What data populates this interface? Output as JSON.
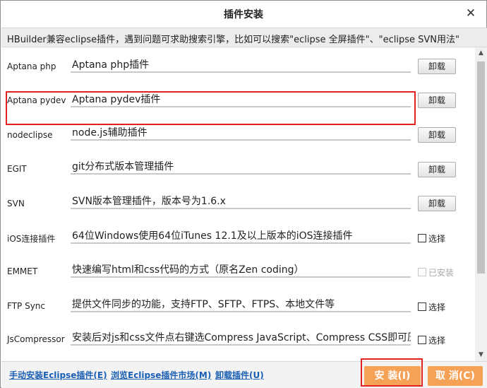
{
  "dialog": {
    "title": "插件安装",
    "close_glyph": "✕"
  },
  "notice": "HBuilder兼容eclipse插件，遇到问题可求助搜索引擎，比如可以搜索\"eclipse 全屏插件\"、\"eclipse SVN用法\"",
  "plugins": [
    {
      "name": "Aptana php",
      "description": "Aptana php插件",
      "action": "卸载",
      "type": "button"
    },
    {
      "name": "Aptana pydev",
      "description": "Aptana pydev插件",
      "action": "卸载",
      "type": "button"
    },
    {
      "name": "nodeclipse",
      "description": "node.js辅助插件",
      "action": "卸载",
      "type": "button"
    },
    {
      "name": "EGIT",
      "description": "git分布式版本管理插件",
      "action": "卸载",
      "type": "button"
    },
    {
      "name": "SVN",
      "description": "SVN版本管理插件，版本号为1.6.x",
      "action": "卸载",
      "type": "button"
    },
    {
      "name": "iOS连接插件",
      "description": "64位Windows使用64位iTunes 12.1及以上版本的iOS连接插件",
      "action": "选择",
      "type": "checkbox"
    },
    {
      "name": "EMMET",
      "description": "快速编写html和css代码的方式（原名Zen coding）",
      "action": "已安装",
      "type": "checkbox-disabled"
    },
    {
      "name": "FTP Sync",
      "description": "提供文件同步的功能，支持FTP、SFTP、FTPS、本地文件等",
      "action": "选择",
      "type": "checkbox"
    },
    {
      "name": "JsCompressor",
      "description": "安装后对js和css文件点右键选Compress JavaScript、Compress CSS即可压缩",
      "action": "选择",
      "type": "checkbox"
    }
  ],
  "footer": {
    "manual_install": "手动安装Eclipse插件(E)",
    "browse_market": "浏览Eclipse插件市场(M)",
    "uninstall": "卸载插件(U)",
    "install": "安 装(I)",
    "cancel": "取 消(C)"
  },
  "scrollbar": {
    "up_glyph": "▲",
    "down_glyph": "▼"
  },
  "colors": {
    "accent_button": "#f6a256",
    "link": "#1a5fb4",
    "highlight": "#e02222"
  }
}
